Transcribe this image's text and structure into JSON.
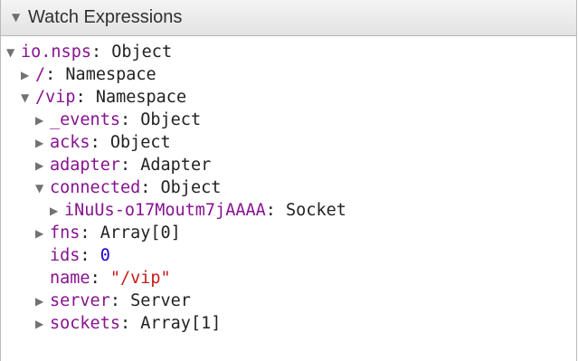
{
  "section": {
    "title": "Watch Expressions",
    "arrow_icon": "triangle-down-icon"
  },
  "colors": {
    "key": "#881391",
    "number": "#1c00cf",
    "string": "#c41a16",
    "text": "#222222"
  },
  "tree": [
    {
      "key": "io.nsps",
      "value": "Object",
      "value_kind": "type",
      "toggle": "expanded",
      "depth": 0
    },
    {
      "key": "/",
      "value": "Namespace",
      "value_kind": "type",
      "toggle": "collapsed",
      "depth": 1
    },
    {
      "key": "/vip",
      "value": "Namespace",
      "value_kind": "type",
      "toggle": "expanded",
      "depth": 1
    },
    {
      "key": "_events",
      "value": "Object",
      "value_kind": "type",
      "toggle": "collapsed",
      "depth": 2
    },
    {
      "key": "acks",
      "value": "Object",
      "value_kind": "type",
      "toggle": "collapsed",
      "depth": 2
    },
    {
      "key": "adapter",
      "value": "Adapter",
      "value_kind": "type",
      "toggle": "collapsed",
      "depth": 2
    },
    {
      "key": "connected",
      "value": "Object",
      "value_kind": "type",
      "toggle": "expanded",
      "depth": 2
    },
    {
      "key": "iNuUs-o17Moutm7jAAAA",
      "value": "Socket",
      "value_kind": "type",
      "toggle": "collapsed",
      "depth": 3
    },
    {
      "key": "fns",
      "value": "Array[0]",
      "value_kind": "type",
      "toggle": "collapsed",
      "depth": 2
    },
    {
      "key": "ids",
      "value": "0",
      "value_kind": "number",
      "toggle": "none",
      "depth": 2
    },
    {
      "key": "name",
      "value": "\"/vip\"",
      "value_kind": "string",
      "toggle": "none",
      "depth": 2
    },
    {
      "key": "server",
      "value": "Server",
      "value_kind": "type",
      "toggle": "collapsed",
      "depth": 2
    },
    {
      "key": "sockets",
      "value": "Array[1]",
      "value_kind": "type",
      "toggle": "collapsed",
      "depth": 2
    }
  ]
}
